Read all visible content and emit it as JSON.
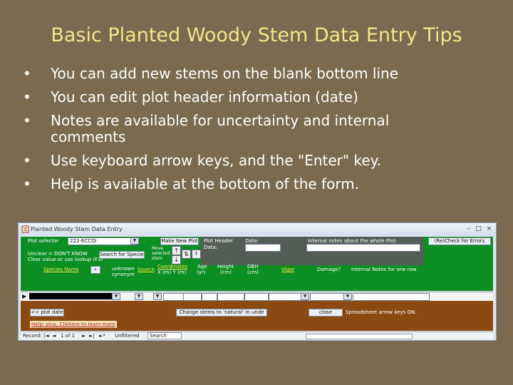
{
  "slide": {
    "title": "Basic Planted Woody Stem Data Entry Tips",
    "bullets": [
      "You can add new stems on the blank bottom line",
      "You can edit plot header information (date)",
      "Notes are available for uncertainty and internal comments",
      "Use keyboard arrow keys, and the \"Enter\" key.",
      "Help is available at the bottom of the form."
    ]
  },
  "form": {
    "window_title": "Planted Woody Stem Data Entry",
    "plot_select_label": "Plot selector",
    "plot_select_value": "222-6CCOI",
    "make_new_plot": "Make New Plot",
    "plot_header_label": "Plot Header Data:",
    "date_label": "Date:",
    "internal_notes_label": "Internal notes about the whole Plot:",
    "check_for_errors": "(Re)Check for Errors",
    "search_for_species": "Search for Species",
    "species_hint_1": "Unclear = DON'T KNOW",
    "species_hint_2": "Clear value or use lookup (F3)",
    "move_selected_label": "Move selected stem",
    "columns": {
      "species_name": "Species Name",
      "unknown_synonym": "unknown synonym",
      "source": "Source",
      "coordinates": "Coordinates",
      "coord_units": "X (m)    Y (m)",
      "age": "Age",
      "age_units": "(yr)",
      "height": "Height",
      "height_units": "(cm)",
      "dbh": "DBH",
      "dbh_units": "(cm)",
      "vigor": "Vigor",
      "damage": "Damage?",
      "notes": "Internal Notes for one row"
    },
    "go_to_plot_date": "<< plot date",
    "change_stems": "Change stems to 'natural' in unde",
    "close": "close",
    "arrow_keys_on": "Spreadsheet arrow keys ON.",
    "help_link": "Help: plus, Clikhere to learn more",
    "nav": {
      "record_label": "Record:",
      "first": "|◄",
      "prev": "◄",
      "position": "1 of 1",
      "next": "►",
      "last": "►|",
      "new": "►*",
      "filter": "Unfiltered",
      "search": "Search"
    }
  }
}
